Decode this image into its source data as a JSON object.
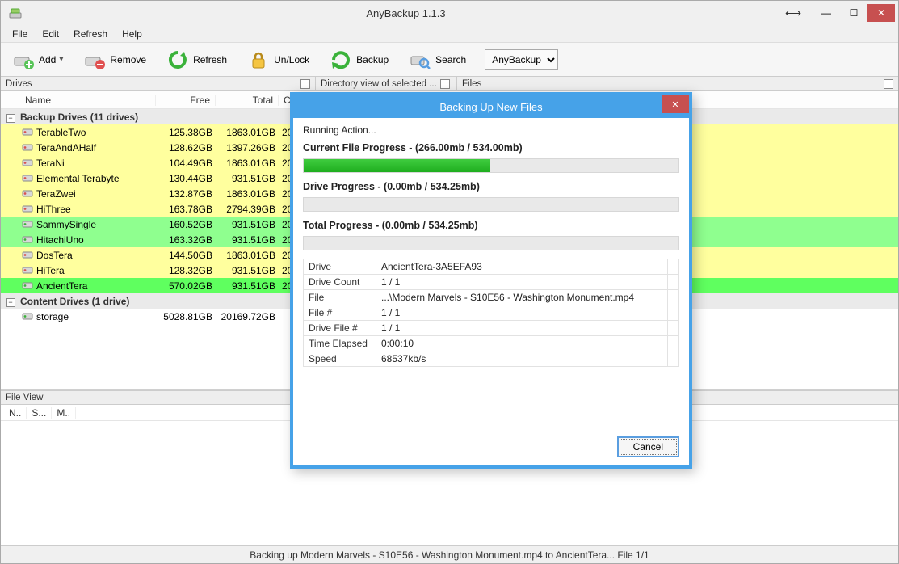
{
  "window": {
    "title": "AnyBackup 1.1.3"
  },
  "wincontrols": {
    "move_glyph": "⟷",
    "minimize": "—",
    "maximize": "☐",
    "close": "✕"
  },
  "menu": {
    "file": "File",
    "edit": "Edit",
    "refresh": "Refresh",
    "help": "Help"
  },
  "toolbar": {
    "add": "Add",
    "remove": "Remove",
    "refresh": "Refresh",
    "unlock": "Un/Lock",
    "backup": "Backup",
    "search": "Search",
    "select_options": [
      "AnyBackup"
    ],
    "select_value": "AnyBackup"
  },
  "panelbar": {
    "drives": "Drives",
    "dirview": "Directory view of selected ...",
    "files": "Files"
  },
  "drives_table": {
    "columns": {
      "name": "Name",
      "free": "Free",
      "total": "Total",
      "chk": "Chk..."
    },
    "group_backup": "Backup Drives (11 drives)",
    "group_content": "Content Drives (1 drive)",
    "backup_rows": [
      {
        "name": "TerableTwo",
        "free": "125.38GB",
        "total": "1863.01GB",
        "chk": "2014",
        "color": "yellow",
        "icon": "drive-red-icon"
      },
      {
        "name": "TeraAndAHalf",
        "free": "128.62GB",
        "total": "1397.26GB",
        "chk": "2014",
        "color": "yellow",
        "icon": "drive-red-icon"
      },
      {
        "name": "TeraNi",
        "free": "104.49GB",
        "total": "1863.01GB",
        "chk": "2014",
        "color": "yellow",
        "icon": "drive-red-icon"
      },
      {
        "name": "Elemental Terabyte",
        "free": "130.44GB",
        "total": "931.51GB",
        "chk": "2014",
        "color": "yellow",
        "icon": "drive-red-icon"
      },
      {
        "name": "TeraZwei",
        "free": "132.87GB",
        "total": "1863.01GB",
        "chk": "2014",
        "color": "yellow",
        "icon": "drive-red-icon"
      },
      {
        "name": "HiThree",
        "free": "163.78GB",
        "total": "2794.39GB",
        "chk": "2014",
        "color": "yellow",
        "icon": "drive-red-icon"
      },
      {
        "name": "SammySingle",
        "free": "160.52GB",
        "total": "931.51GB",
        "chk": "2014",
        "color": "green",
        "icon": "drive-green-icon"
      },
      {
        "name": "HitachiUno",
        "free": "163.32GB",
        "total": "931.51GB",
        "chk": "2014",
        "color": "green",
        "icon": "drive-green-icon"
      },
      {
        "name": "DosTera",
        "free": "144.50GB",
        "total": "1863.01GB",
        "chk": "2014",
        "color": "yellow",
        "icon": "drive-red-icon"
      },
      {
        "name": "HiTera",
        "free": "128.32GB",
        "total": "931.51GB",
        "chk": "2014",
        "color": "yellow",
        "icon": "drive-red-icon"
      },
      {
        "name": "AncientTera",
        "free": "570.02GB",
        "total": "931.51GB",
        "chk": "2014",
        "color": "lime",
        "icon": "drive-green-icon"
      }
    ],
    "content_rows": [
      {
        "name": "storage",
        "free": "5028.81GB",
        "total": "20169.72GB",
        "chk": "",
        "color": "white",
        "icon": "drive-green-icon"
      }
    ]
  },
  "file_view": {
    "header": "File View",
    "cols": [
      "N..",
      "S...",
      "M.."
    ]
  },
  "statusbar": {
    "text": "Backing up Modern Marvels - S10E56 - Washington Monument.mp4 to AncientTera... File 1/1"
  },
  "dialog": {
    "title": "Backing Up New Files",
    "running": "Running Action...",
    "current_label_prefix": "Current File Progress - ",
    "current_values": "(266.00mb / 534.00mb)",
    "current_pct": 49.8,
    "drive_label_prefix": "Drive Progress - ",
    "drive_values": "(0.00mb / 534.25mb)",
    "drive_pct": 0,
    "total_label_prefix": "Total Progress - ",
    "total_values": "(0.00mb / 534.25mb)",
    "total_pct": 0,
    "info": {
      "drive_k": "Drive",
      "drive_v": "AncientTera-3A5EFA93",
      "count_k": "Drive Count",
      "count_v": "1 / 1",
      "file_k": "File",
      "file_v": "...\\Modern Marvels - S10E56 - Washington Monument.mp4",
      "fileno_k": "File #",
      "fileno_v": "1 / 1",
      "dfile_k": "Drive File #",
      "dfile_v": "1 / 1",
      "elapsed_k": "Time Elapsed",
      "elapsed_v": "0:00:10",
      "speed_k": "Speed",
      "speed_v": "68537kb/s"
    },
    "cancel": "Cancel",
    "close": "✕"
  }
}
